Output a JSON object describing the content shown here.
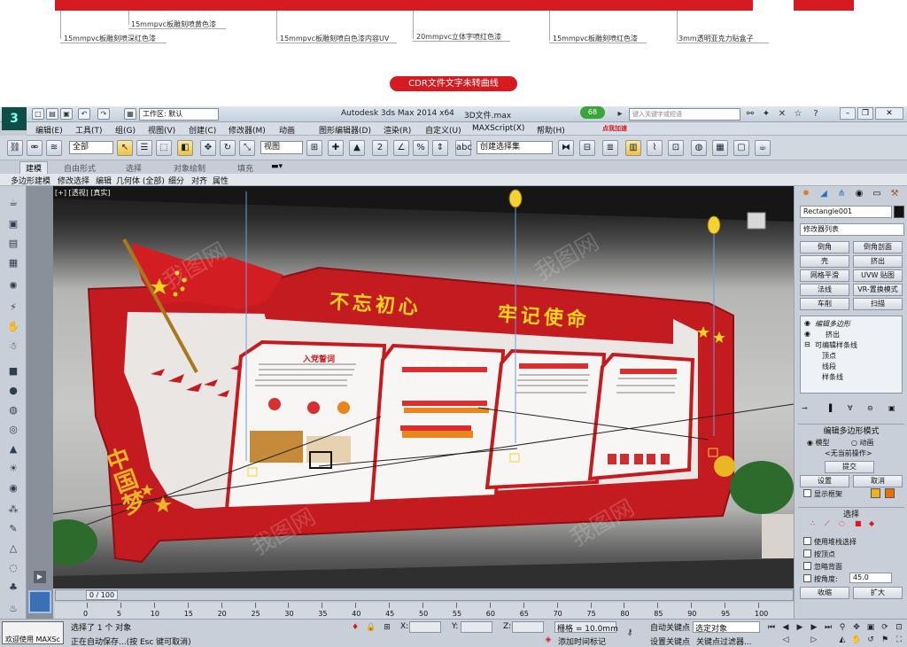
{
  "spec_notes": [
    "15mmpvc板雕刻喷黄色漆",
    "15mmpvc板雕刻喷深红色漆",
    "15mmpvc板雕刻喷白色漆内容UV",
    "20mmpvc立体字喷红色漆",
    "15mmpvc板雕刻喷红色漆",
    "3mm透明亚克力贴盒子"
  ],
  "cdr_note": "CDR文件文字未转曲线",
  "titlebar": {
    "workspace_label": "工作区: 默认",
    "app_title": "Autodesk 3ds Max  2014 x64",
    "doc_title": "3D文件.max",
    "badge": "68",
    "search_placeholder": "键入关键字或短语"
  },
  "menu": [
    "编辑(E)",
    "工具(T)",
    "组(G)",
    "视图(V)",
    "创建(C)",
    "修改器(M)",
    "动画",
    "图形编辑器(D)",
    "渲染(R)",
    "自定义(U)",
    "MAXScript(X)",
    "帮助(H)"
  ],
  "promo": "点我加速",
  "toolbar": {
    "filter": "全部",
    "refcoord": "视图",
    "selset": "创建选择集"
  },
  "ribbon_tabs": [
    "建模",
    "自由形式",
    "选择",
    "对象绘制",
    "填充"
  ],
  "ribbon_sub": [
    "多边形建模",
    "修改选择",
    "编辑",
    "几何体 (全部)",
    "细分",
    "对齐",
    "属性"
  ],
  "viewport": {
    "label": "[+] [透视] [真实]",
    "scene": {
      "headline_left": "不忘初心",
      "headline_right": "牢记使命",
      "panel1_title": "入党誓词",
      "panel2_title": "从 \"四风\" 到 \"八项\" 规定",
      "china_dream": "中国梦"
    }
  },
  "cmdpanel": {
    "object_name": "Rectangle001",
    "modifier_list": "修改器列表",
    "buttons": [
      "倒角",
      "倒角剖面",
      "壳",
      "挤出",
      "网格平滑",
      "UVW 贴图",
      "法线",
      "VR-置换模式",
      "车削",
      "扫描"
    ],
    "stack": [
      "编辑多边形",
      "挤出",
      "可编辑样条线",
      "顶点",
      "线段",
      "样条线"
    ],
    "edit_poly_title": "编辑多边形模式",
    "mode_model": "模型",
    "mode_anim": "动画",
    "no_op": "<无当前操作>",
    "commit": "提交",
    "settings": "设置",
    "cancel": "取消",
    "show_cage": "显示框架",
    "select_title": "选择",
    "by_vertex_stack": "使用堆栈选择",
    "by_vertex": "按顶点",
    "ignore_back": "忽略背面",
    "by_angle": "按角度:",
    "angle_val": "45.0",
    "shrink": "收缩",
    "grow": "扩大"
  },
  "timeline": {
    "frame": "0 / 100",
    "ticks": [
      "0",
      "5",
      "10",
      "15",
      "20",
      "25",
      "30",
      "35",
      "40",
      "45",
      "50",
      "55",
      "60",
      "65",
      "70",
      "75",
      "80",
      "85",
      "90",
      "95",
      "100"
    ]
  },
  "status": {
    "welcome": "欢迎使用 MAXSc",
    "selected": "选择了 1 个 对象",
    "autosave": "正在自动保存...(按 Esc 键可取消)",
    "x_label": "X:",
    "y_label": "Y:",
    "z_label": "Z:",
    "grid": "栅格 = 10.0mm",
    "add_time": "添加时间标记",
    "autokey": "自动关键点",
    "setkey": "设置关键点",
    "sel_obj": "选定对象",
    "key_filter": "关键点过滤器..."
  }
}
